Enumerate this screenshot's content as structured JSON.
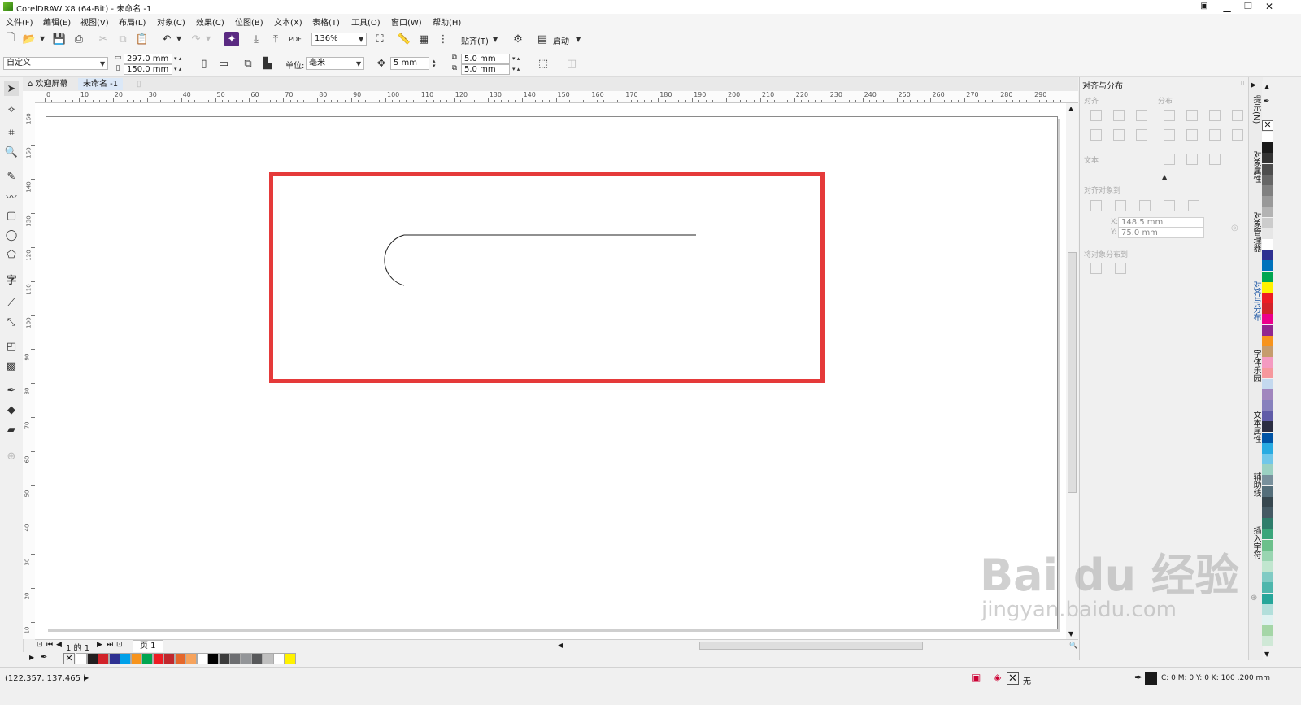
{
  "window": {
    "title": "CorelDRAW X8 (64-Bit) - 未命名 -1"
  },
  "menu": [
    "文件(F)",
    "编辑(E)",
    "视图(V)",
    "布局(L)",
    "对象(C)",
    "效果(C)",
    "位图(B)",
    "文本(X)",
    "表格(T)",
    "工具(O)",
    "窗口(W)",
    "帮助(H)"
  ],
  "toolbar": {
    "zoom": "136%",
    "snap_label": "贴齐(T)",
    "launch_label": "启动"
  },
  "propbar": {
    "preset": "自定义",
    "width": "297.0 mm",
    "height": "150.0 mm",
    "unit_label": "单位:",
    "unit_value": "毫米",
    "nudge": "5 mm",
    "dup_x": "5.0 mm",
    "dup_y": "5.0 mm"
  },
  "tabs": {
    "welcome": "欢迎屏幕",
    "doc": "未命名 -1"
  },
  "ruler": {
    "h_labels": [
      "0",
      "10",
      "20",
      "30",
      "40",
      "50",
      "60",
      "70",
      "80",
      "90",
      "100",
      "110",
      "120",
      "130",
      "140",
      "150",
      "160",
      "170",
      "180",
      "190",
      "200",
      "210",
      "220",
      "230",
      "240",
      "250",
      "260",
      "270",
      "280",
      "290"
    ],
    "v_labels": [
      "160",
      "150",
      "140",
      "130",
      "120",
      "110",
      "100",
      "90",
      "80",
      "70",
      "60",
      "50",
      "40",
      "30",
      "20",
      "10",
      "0"
    ]
  },
  "page_nav": {
    "position": "1 的 1",
    "page_tab": "页 1"
  },
  "docker": {
    "title": "对齐与分布",
    "align_label": "对齐",
    "distribute_label": "分布",
    "text_label": "文本",
    "align_objects_to_label": "对齐对象到",
    "x_value": "148.5 mm",
    "y_value": "75.0 mm",
    "distribute_to_label": "将对象分布到"
  },
  "side_tabs": [
    "提示(N)",
    "对象属性",
    "对象管理器",
    "对齐与分布",
    "字体乐园",
    "文本属性",
    "辅助线",
    "插入字符"
  ],
  "status": {
    "coords": "(122.357, 137.465 )",
    "fill_none": "无",
    "outline_info": "C: 0 M: 0 Y: 0 K: 100  .200 mm"
  },
  "watermark": {
    "brand": "Bai  du 经验",
    "url": "jingyan.baidu.com"
  },
  "colors": {
    "highlight": "#e53a3a",
    "accent": "#1a1a1a"
  },
  "bottom_palette": [
    "#ffffff",
    "#231f20",
    "#d2232a",
    "#2e3192",
    "#00a0e9",
    "#f7941d",
    "#00a651",
    "#ed1c24",
    "#c1272d",
    "#e5672b",
    "#f7a35c",
    "#ffffff",
    "#000000",
    "#3c3c3c",
    "#6d6e71",
    "#939598",
    "#58595b",
    "#c0c0c0",
    "#ffffff",
    "#fff200"
  ],
  "right_palette": [
    "#ffffff",
    "#1a1a1a",
    "#333333",
    "#4d4d4d",
    "#666666",
    "#808080",
    "#999999",
    "#b3b3b3",
    "#cccccc",
    "#e6e6e6",
    "#ffffff",
    "#2e3192",
    "#0072bc",
    "#00a651",
    "#fff200",
    "#ed1c24",
    "#d2232a",
    "#ec008c",
    "#92278f",
    "#f7941d",
    "#c69c6d",
    "#f49ac1",
    "#f6989d",
    "#c4d9ef",
    "#a186be",
    "#8781bd",
    "#605ca8",
    "#2b2d42",
    "#0054a6",
    "#29abe2",
    "#71c7e9",
    "#9bd1c2",
    "#78909c",
    "#546e7a",
    "#37474f",
    "#455a64",
    "#2e7d6b",
    "#3aa57a",
    "#6cc08b",
    "#99d5b1",
    "#c1e6cf",
    "#80cbc4",
    "#4db6ac",
    "#26a69a",
    "#b2dfdb",
    "#e0f2f1",
    "#a5d6a7",
    "#cfe8d6"
  ]
}
